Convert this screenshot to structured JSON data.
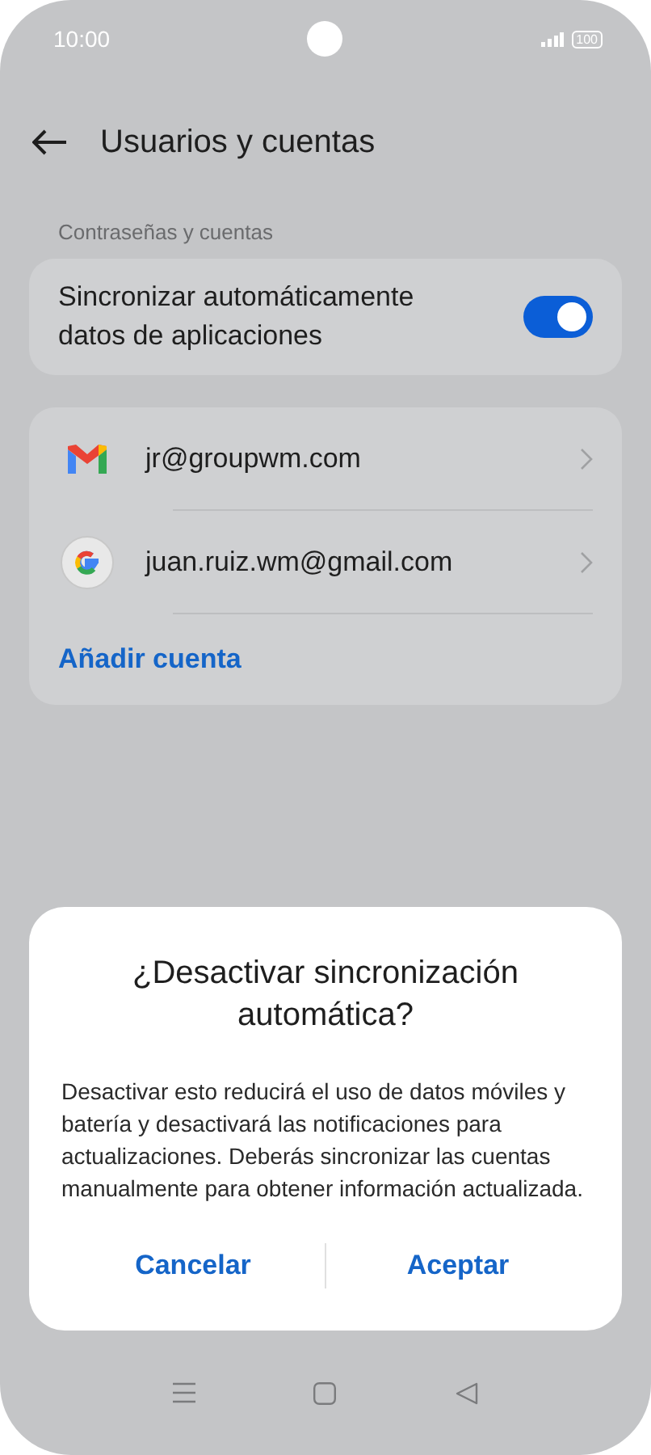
{
  "status_bar": {
    "time": "10:00",
    "battery": "100"
  },
  "header": {
    "title": "Usuarios y cuentas"
  },
  "section_label": "Contraseñas y cuentas",
  "sync_setting": {
    "label": "Sincronizar automáticamente datos de aplicaciones",
    "on": true
  },
  "accounts": [
    {
      "kind": "gmail",
      "email": "jr@groupwm.com"
    },
    {
      "kind": "google",
      "email": "juan.ruiz.wm@gmail.com"
    }
  ],
  "add_account": "Añadir cuenta",
  "dialog": {
    "title": "¿Desactivar sincronización automática?",
    "message": "Desactivar esto reducirá el uso de datos móviles y batería y desactivará las notificaciones para actualizaciones. Deberás sincronizar las cuentas manualmente para obtener información actualizada.",
    "buttons": [
      "Cancelar",
      "Aceptar"
    ]
  }
}
